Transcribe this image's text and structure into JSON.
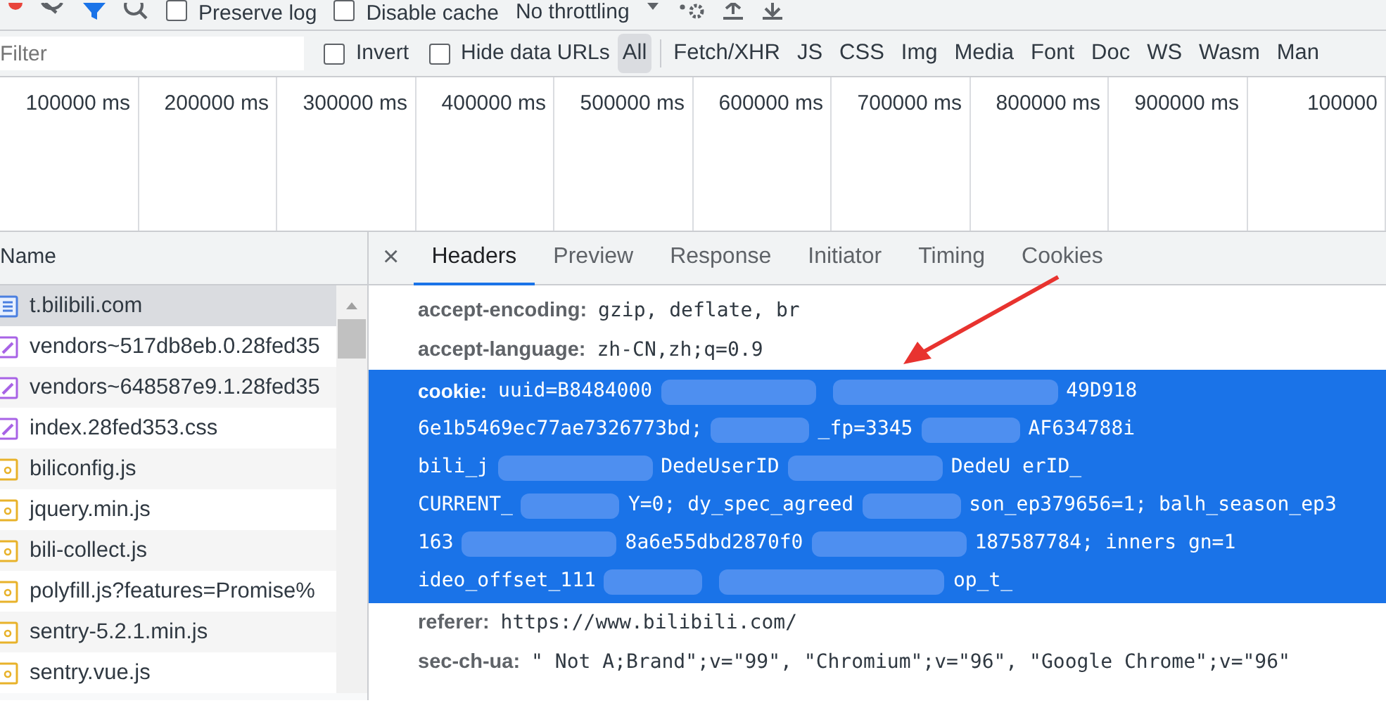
{
  "toolbar": {
    "filter_toggle": {
      "on": true
    },
    "checkboxes": [
      {
        "label": "Preserve log",
        "checked": false
      },
      {
        "label": "Disable cache",
        "checked": false
      }
    ],
    "throttling": {
      "value": "No throttling"
    }
  },
  "filter_bar": {
    "placeholder": "Filter",
    "checkboxes": [
      {
        "label": "Invert",
        "checked": false
      },
      {
        "label": "Hide data URLs",
        "checked": false
      }
    ],
    "types": [
      {
        "label": "All",
        "selected": true
      },
      {
        "label": "Fetch/XHR",
        "selected": false
      },
      {
        "label": "JS",
        "selected": false
      },
      {
        "label": "CSS",
        "selected": false
      },
      {
        "label": "Img",
        "selected": false
      },
      {
        "label": "Media",
        "selected": false
      },
      {
        "label": "Font",
        "selected": false
      },
      {
        "label": "Doc",
        "selected": false
      },
      {
        "label": "WS",
        "selected": false
      },
      {
        "label": "Wasm",
        "selected": false
      },
      {
        "label": "Man",
        "selected": false
      }
    ]
  },
  "overview": {
    "ticks": [
      "100000 ms",
      "200000 ms",
      "300000 ms",
      "400000 ms",
      "500000 ms",
      "600000 ms",
      "700000 ms",
      "800000 ms",
      "900000 ms",
      "100000"
    ]
  },
  "requests": {
    "column": "Name",
    "rows": [
      {
        "name": "t.bilibili.com",
        "kind": "document",
        "selected": true
      },
      {
        "name": "vendors~517db8eb.0.28fed35",
        "kind": "stylesheet",
        "selected": false
      },
      {
        "name": "vendors~648587e9.1.28fed35",
        "kind": "stylesheet",
        "selected": false
      },
      {
        "name": "index.28fed353.css",
        "kind": "stylesheet",
        "selected": false
      },
      {
        "name": "biliconfig.js",
        "kind": "script",
        "selected": false
      },
      {
        "name": "jquery.min.js",
        "kind": "script",
        "selected": false
      },
      {
        "name": "bili-collect.js",
        "kind": "script",
        "selected": false
      },
      {
        "name": "polyfill.js?features=Promise%",
        "kind": "script",
        "selected": false
      },
      {
        "name": "sentry-5.2.1.min.js",
        "kind": "script",
        "selected": false
      },
      {
        "name": "sentry.vue.js",
        "kind": "script",
        "selected": false
      }
    ]
  },
  "details": {
    "close_label": "×",
    "tabs": [
      {
        "label": "Headers",
        "selected": true
      },
      {
        "label": "Preview",
        "selected": false
      },
      {
        "label": "Response",
        "selected": false
      },
      {
        "label": "Initiator",
        "selected": false
      },
      {
        "label": "Timing",
        "selected": false
      },
      {
        "label": "Cookies",
        "selected": false
      }
    ],
    "headers": [
      {
        "name": "accept-encoding:",
        "kind": "plain",
        "selected": false,
        "value": "gzip, deflate, br"
      },
      {
        "name": "accept-language:",
        "kind": "plain",
        "selected": false,
        "value": "zh-CN,zh;q=0.9"
      },
      {
        "name": "cookie:",
        "kind": "redacted",
        "selected": true,
        "lines": [
          [
            "uuid=B8484000",
            "49D918"
          ],
          [
            "6e1b5469ec77ae7326773bd;",
            "_fp=3345",
            "AF634788i"
          ],
          [
            "bili_j",
            "DedeUserID",
            "DedeU erID_"
          ],
          [
            "CURRENT_",
            "Y=0; dy_spec_agreed",
            "son_ep379656=1; balh_season_ep3"
          ],
          [
            "163",
            "8a6e55dbd2870f0",
            "187587784; inners gn=1"
          ],
          [
            "ideo_offset_111",
            "op_t_"
          ]
        ]
      },
      {
        "name": "referer:",
        "kind": "plain",
        "selected": false,
        "value": "https://www.bilibili.com/"
      },
      {
        "name": "sec-ch-ua:",
        "kind": "plain",
        "selected": false,
        "value": "\" Not A;Brand\";v=\"99\", \"Chromium\";v=\"96\", \"Google Chrome\";v=\"96\""
      }
    ]
  }
}
